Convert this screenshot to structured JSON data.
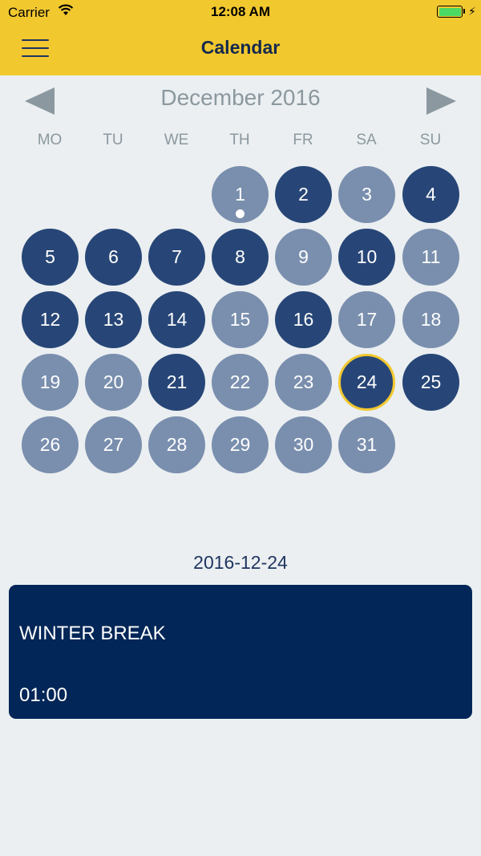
{
  "status_bar": {
    "carrier": "Carrier",
    "time": "12:08 AM"
  },
  "nav": {
    "title": "Calendar"
  },
  "calendar": {
    "month_label": "December 2016",
    "weekdays": [
      "MO",
      "TU",
      "WE",
      "TH",
      "FR",
      "SA",
      "SU"
    ],
    "days": [
      {
        "label": "1",
        "style": "light",
        "event_dot": true
      },
      {
        "label": "2",
        "style": "dark"
      },
      {
        "label": "3",
        "style": "light"
      },
      {
        "label": "4",
        "style": "dark"
      },
      {
        "label": "5",
        "style": "dark"
      },
      {
        "label": "6",
        "style": "dark"
      },
      {
        "label": "7",
        "style": "dark"
      },
      {
        "label": "8",
        "style": "dark"
      },
      {
        "label": "9",
        "style": "light"
      },
      {
        "label": "10",
        "style": "dark"
      },
      {
        "label": "11",
        "style": "light"
      },
      {
        "label": "12",
        "style": "dark"
      },
      {
        "label": "13",
        "style": "dark"
      },
      {
        "label": "14",
        "style": "dark"
      },
      {
        "label": "15",
        "style": "light"
      },
      {
        "label": "16",
        "style": "dark"
      },
      {
        "label": "17",
        "style": "light"
      },
      {
        "label": "18",
        "style": "light"
      },
      {
        "label": "19",
        "style": "light"
      },
      {
        "label": "20",
        "style": "light"
      },
      {
        "label": "21",
        "style": "dark"
      },
      {
        "label": "22",
        "style": "light"
      },
      {
        "label": "23",
        "style": "light"
      },
      {
        "label": "24",
        "style": "dark",
        "selected": true
      },
      {
        "label": "25",
        "style": "dark"
      },
      {
        "label": "26",
        "style": "light"
      },
      {
        "label": "27",
        "style": "light"
      },
      {
        "label": "28",
        "style": "light"
      },
      {
        "label": "29",
        "style": "light"
      },
      {
        "label": "30",
        "style": "light"
      },
      {
        "label": "31",
        "style": "light"
      }
    ]
  },
  "selected_date": "2016-12-24",
  "events": [
    {
      "title": "WINTER BREAK",
      "time": "01:00"
    }
  ],
  "colors": {
    "accent_yellow": "#f2c82f",
    "day_dark": "#274677",
    "day_light": "#7a8fae",
    "card_bg": "#022657"
  }
}
